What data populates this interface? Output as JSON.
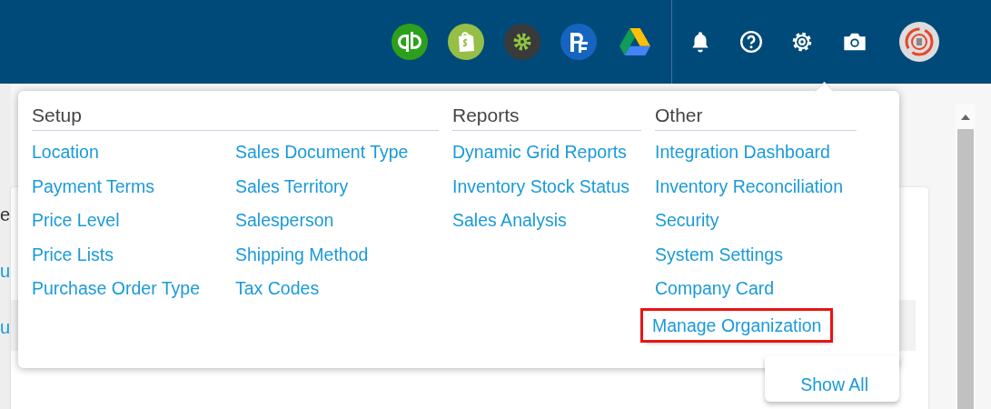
{
  "background_fragments": [
    {
      "text": "e"
    },
    {
      "text": "u"
    },
    {
      "text": "u"
    }
  ],
  "menu": {
    "sections": [
      {
        "title": "Setup",
        "columns": [
          [
            {
              "label": "Location",
              "highlighted": false
            },
            {
              "label": "Payment Terms",
              "highlighted": false
            },
            {
              "label": "Price Level",
              "highlighted": false
            },
            {
              "label": "Price Lists",
              "highlighted": false
            },
            {
              "label": "Purchase Order Type",
              "highlighted": false
            }
          ],
          [
            {
              "label": "Sales Document Type",
              "highlighted": false
            },
            {
              "label": "Sales Territory",
              "highlighted": false
            },
            {
              "label": "Salesperson",
              "highlighted": false
            },
            {
              "label": "Shipping Method",
              "highlighted": false
            },
            {
              "label": "Tax Codes",
              "highlighted": false
            }
          ]
        ]
      },
      {
        "title": "Reports",
        "columns": [
          [
            {
              "label": "Dynamic Grid Reports",
              "highlighted": false
            },
            {
              "label": "Inventory Stock Status",
              "highlighted": false
            },
            {
              "label": "Sales Analysis",
              "highlighted": false
            }
          ]
        ]
      },
      {
        "title": "Other",
        "columns": [
          [
            {
              "label": "Integration Dashboard",
              "highlighted": false
            },
            {
              "label": "Inventory Reconciliation",
              "highlighted": false
            },
            {
              "label": "Security",
              "highlighted": false
            },
            {
              "label": "System Settings",
              "highlighted": false
            },
            {
              "label": "Company Card",
              "highlighted": false
            },
            {
              "label": "Manage Organization",
              "highlighted": true
            }
          ]
        ]
      }
    ],
    "show_all": "Show All"
  }
}
